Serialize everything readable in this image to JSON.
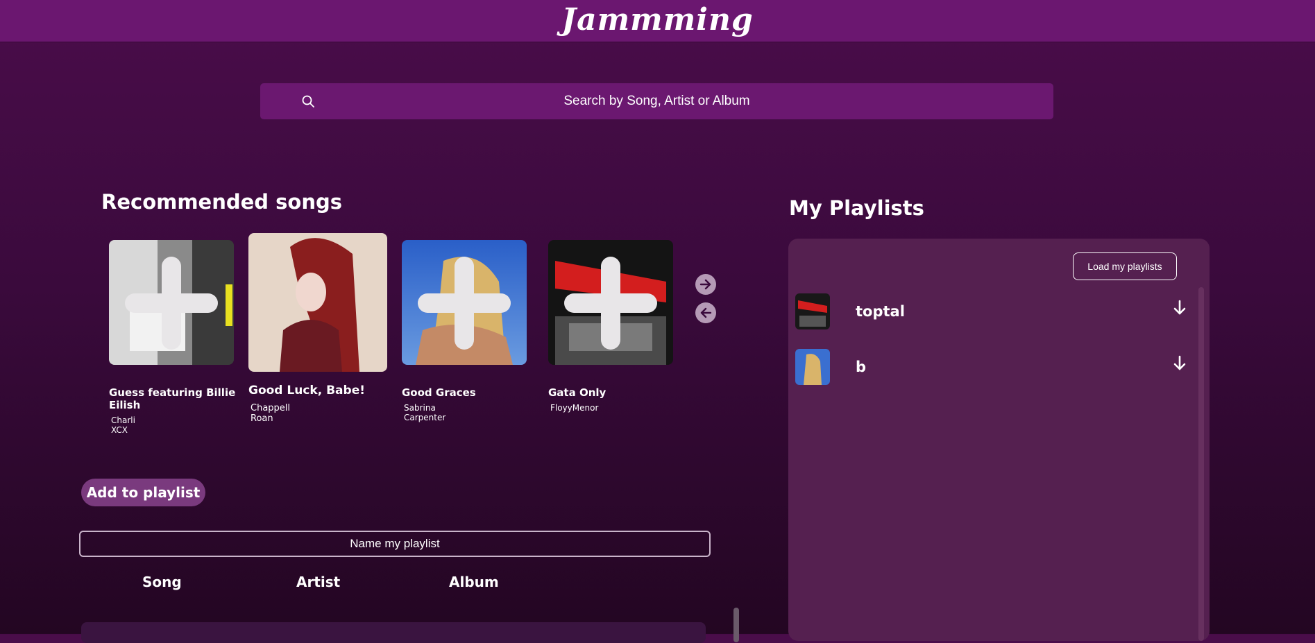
{
  "header": {
    "logo_text": "Jammming"
  },
  "search": {
    "placeholder": "Search by Song, Artist or Album",
    "icon": "search-icon"
  },
  "recommended": {
    "title": "Recommended songs",
    "songs": [
      {
        "title": "Guess featuring Billie Eilish",
        "artist": "Charli XCX"
      },
      {
        "title": "Good Luck, Babe!",
        "artist": "Chappell Roan"
      },
      {
        "title": "Good Graces",
        "artist": "Sabrina Carpenter"
      },
      {
        "title": "Gata Only",
        "artist": "FloyyMenor"
      }
    ],
    "next_icon": "arrow-right-icon",
    "prev_icon": "arrow-left-icon"
  },
  "builder": {
    "add_button": "Add to playlist",
    "name_placeholder": "Name my playlist",
    "columns": [
      "Song",
      "Artist",
      "Album"
    ]
  },
  "playlists": {
    "title": "My Playlists",
    "load_button": "Load my playlists",
    "items": [
      {
        "name": "toptal",
        "icon": "download-arrow-icon"
      },
      {
        "name": "b",
        "icon": "download-arrow-icon"
      }
    ]
  },
  "colors": {
    "header_bg": "#6b1770",
    "accent": "#7a3a7e",
    "panel_bg": "#552050"
  }
}
